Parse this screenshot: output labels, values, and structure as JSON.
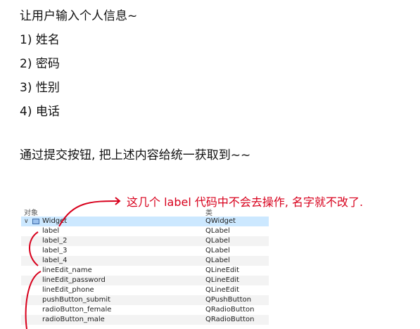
{
  "text": {
    "line1": "让用户输入个人信息~",
    "line2": "1) 姓名",
    "line3": "2) 密码",
    "line4": "3) 性别",
    "line5": "4) 电话",
    "line6": "通过提交按钮, 把上述内容给统一获取到~~"
  },
  "annotation": {
    "text": "这几个 label 代码中不会去操作, 名字就不改了.",
    "color": "#d8001c"
  },
  "tree": {
    "headers": {
      "object": "对象",
      "class": "类"
    },
    "root": {
      "name": "Widget",
      "class": "QWidget",
      "expand_icon": "chevron-down-icon",
      "icon": "widget-icon"
    },
    "rows": [
      {
        "name": "label",
        "class": "QLabel"
      },
      {
        "name": "label_2",
        "class": "QLabel"
      },
      {
        "name": "label_3",
        "class": "QLabel"
      },
      {
        "name": "label_4",
        "class": "QLabel"
      },
      {
        "name": "lineEdit_name",
        "class": "QLineEdit"
      },
      {
        "name": "lineEdit_password",
        "class": "QLineEdit"
      },
      {
        "name": "lineEdit_phone",
        "class": "QLineEdit"
      },
      {
        "name": "pushButton_submit",
        "class": "QPushButton"
      },
      {
        "name": "radioButton_female",
        "class": "QRadioButton"
      },
      {
        "name": "radioButton_male",
        "class": "QRadioButton"
      }
    ],
    "selected_color": "#cce8ff"
  }
}
